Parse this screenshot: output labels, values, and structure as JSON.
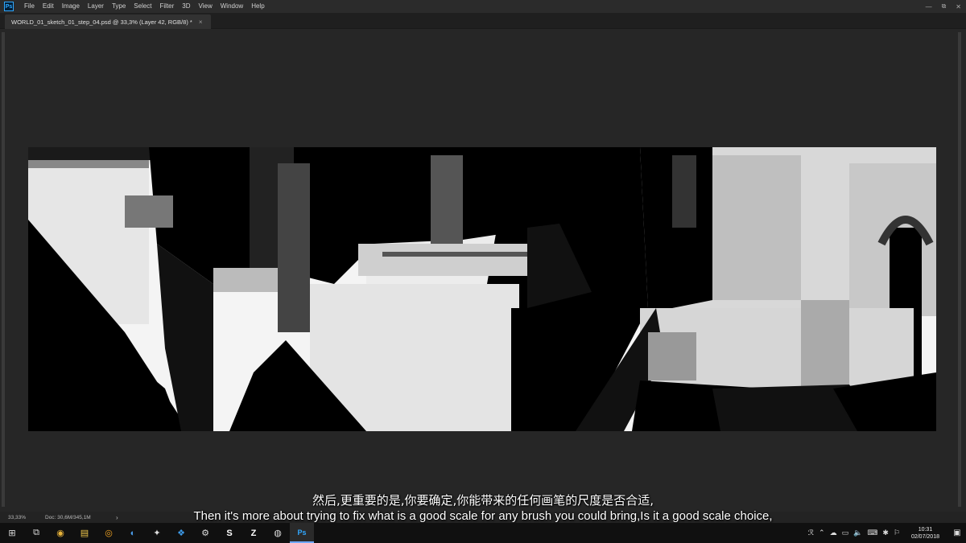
{
  "menu": {
    "items": [
      "File",
      "Edit",
      "Image",
      "Layer",
      "Type",
      "Select",
      "Filter",
      "3D",
      "View",
      "Window",
      "Help"
    ],
    "app_logo": "Ps"
  },
  "window_controls": {
    "minimize": "—",
    "restore": "⧉",
    "close": "✕"
  },
  "document": {
    "tab_title": "WORLD_01_sketch_01_step_04.psd @ 33,3% (Layer 42, RGB/8) *",
    "tab_close": "×"
  },
  "status": {
    "zoom": "33,33%",
    "doc_info": "Doc: 30,6M/345,1M",
    "arrow": "›"
  },
  "subtitles": {
    "chinese": "然后,更重要的是,你要确定,你能带来的任何画笔的尺度是否合适,",
    "english": "Then it's more about trying to fix what is a good scale for any brush you could bring,Is it a good scale choice,"
  },
  "taskbar": {
    "apps": [
      {
        "name": "start-icon",
        "glyph": "⊞"
      },
      {
        "name": "task-view-icon",
        "glyph": "⧉"
      },
      {
        "name": "chrome-icon",
        "glyph": "◉"
      },
      {
        "name": "file-explorer-icon",
        "glyph": "▤"
      },
      {
        "name": "blender-icon",
        "glyph": "◎"
      },
      {
        "name": "app-icon-blue",
        "glyph": "◐"
      },
      {
        "name": "app-icon-bird",
        "glyph": "✦"
      },
      {
        "name": "dropbox-icon",
        "glyph": "❖"
      },
      {
        "name": "settings-icon",
        "glyph": "⚙"
      },
      {
        "name": "skype-icon",
        "glyph": "S"
      },
      {
        "name": "filezilla-icon",
        "glyph": "Z"
      },
      {
        "name": "app-icon-circle",
        "glyph": "◍"
      },
      {
        "name": "photoshop-icon",
        "glyph": "Ps"
      }
    ],
    "tray_icons": [
      "ℛ",
      "⌃",
      "☁",
      "▭",
      "🔈",
      "⌨",
      "✱",
      "⚐"
    ],
    "time": "10:31",
    "date": "02/07/2018",
    "notifications": "▣"
  },
  "colors": {
    "ps_accent": "#31a8ff",
    "menubar_bg": "#2b2b2b",
    "workspace_bg": "#262626",
    "taskbar_bg": "#101010"
  }
}
